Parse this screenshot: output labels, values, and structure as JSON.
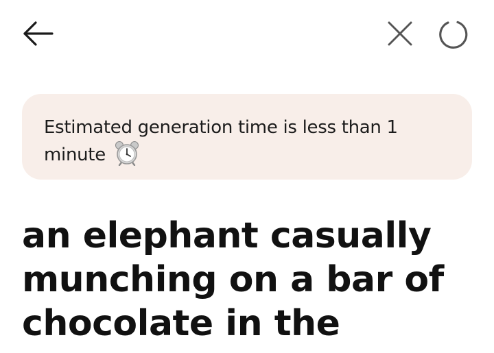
{
  "header": {
    "back_icon": "arrow-left-icon",
    "close_icon": "close-icon",
    "loading_icon": "refresh-spinner-icon",
    "icon_color": "#1a1a1a"
  },
  "notice": {
    "text": "Estimated generation time is less than 1 minute",
    "emoji_icon": "alarm-clock-icon",
    "background": "#f8eee9"
  },
  "prompt": {
    "text": "an elephant casually munching on a bar of chocolate in the"
  }
}
